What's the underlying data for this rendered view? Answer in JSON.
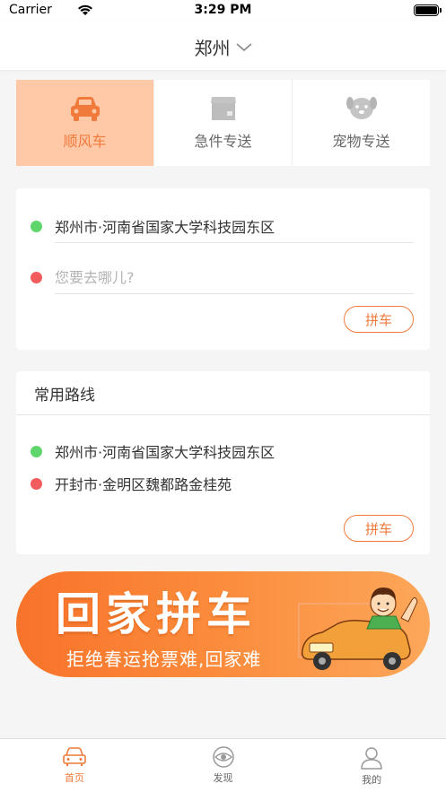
{
  "status_bar": {
    "carrier": "Carrier",
    "time": "3:29 PM"
  },
  "header": {
    "city": "郑州"
  },
  "service_tabs": [
    {
      "label": "顺风车",
      "icon": "car-icon",
      "active": true
    },
    {
      "label": "急件专送",
      "icon": "package-icon",
      "active": false
    },
    {
      "label": "宠物专送",
      "icon": "dog-icon",
      "active": false
    }
  ],
  "trip": {
    "origin": "郑州市·河南省国家大学科技园东区",
    "destination_placeholder": "您要去哪儿?",
    "button": "拼车"
  },
  "routes": {
    "title": "常用路线",
    "origin": "郑州市·河南省国家大学科技园东区",
    "destination": "开封市·金明区魏都路金桂苑",
    "button": "拼车"
  },
  "banner": {
    "title": "回家拼车",
    "subtitle": "拒绝春运抢票难,回家难"
  },
  "tabbar": [
    {
      "label": "首页",
      "active": true
    },
    {
      "label": "发现",
      "active": false
    },
    {
      "label": "我的",
      "active": false
    }
  ],
  "colors": {
    "accent": "#f07a3c",
    "active_tab_bg": "#ffc8a6",
    "origin_dot": "#5ed66b",
    "destination_dot": "#f35c5c"
  }
}
